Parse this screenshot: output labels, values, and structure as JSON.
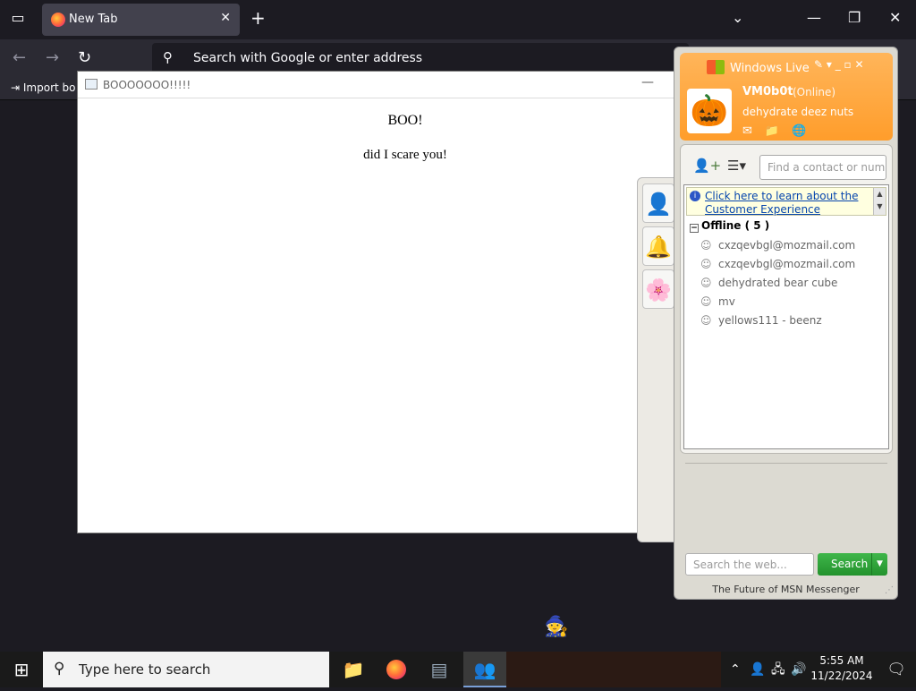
{
  "browser": {
    "tab_title": "New Tab",
    "address_placeholder": "Search with Google or enter address",
    "bookmark_label": "Import bo"
  },
  "popup": {
    "title": "BOOOOOOO!!!!!",
    "heading": "BOO!",
    "text": "did I scare you!"
  },
  "messenger": {
    "brand": "Windows Live",
    "user_name": "VM0b0t",
    "status": "(Online)",
    "personal_message": "dehydrate deez nuts",
    "find_placeholder": "Find a contact or number",
    "info_line1": "Click here to learn about the",
    "info_line2": "Customer Experience",
    "group_label": "Offline ( 5 )",
    "contacts": [
      "cxzqevbgl@mozmail.com",
      "cxzqevbgl@mozmail.com",
      "dehydrated bear cube",
      "mv",
      "yellows111 - beenz"
    ],
    "search_placeholder": "Search the web...",
    "search_button": "Search",
    "footer": "The Future of MSN Messenger"
  },
  "taskbar": {
    "search_text": "Type here to search",
    "time": "5:55 AM",
    "date": "11/22/2024"
  },
  "icons": [
    "tab-list-icon",
    "firefox-icon",
    "close-icon",
    "plus-icon",
    "chevron-down-icon",
    "minimize-icon",
    "restore-icon",
    "back-icon",
    "forward-icon",
    "reload-icon",
    "search-icon",
    "import-icon",
    "buddy-icon",
    "bell-icon",
    "flowers-icon",
    "pumpkin-avatar",
    "add-contact-icon",
    "sort-list-icon",
    "info-icon",
    "contact-icon",
    "windows-icon",
    "folder-icon",
    "network-icon",
    "volume-icon",
    "notification-icon"
  ]
}
